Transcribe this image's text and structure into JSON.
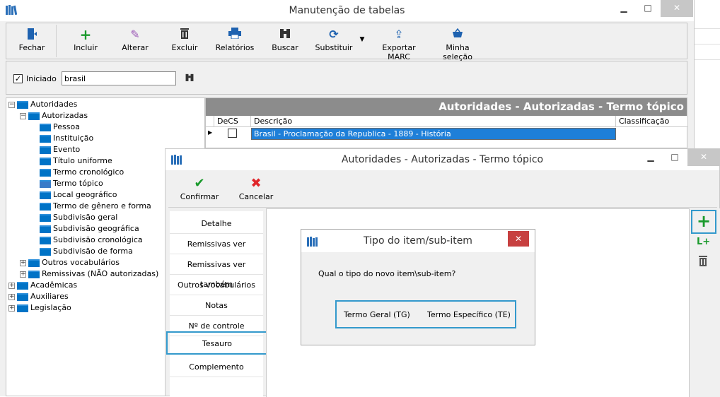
{
  "main_window": {
    "title": "Manutenção de tabelas",
    "minimize": "▁",
    "maximize": "□",
    "close": "✕"
  },
  "toolbar": {
    "fechar": "Fechar",
    "incluir": "Incluir",
    "alterar": "Alterar",
    "excluir": "Excluir",
    "relatorios": "Relatórios",
    "buscar": "Buscar",
    "substituir": "Substituir",
    "exportar": "Exportar MARC",
    "minha_selecao": "Minha seleção"
  },
  "filter": {
    "iniciado_label": "Iniciado",
    "iniciado_checked": "✓",
    "search_value": "brasil"
  },
  "tree": {
    "autoridades": "Autoridades",
    "autorizadas": "Autorizadas",
    "items": [
      "Pessoa",
      "Instituição",
      "Evento",
      "Título uniforme",
      "Termo cronológico",
      "Termo tópico",
      "Local geográfico",
      "Termo de gênero e forma",
      "Subdivisão geral",
      "Subdivisão geográfica",
      "Subdivisão cronológica",
      "Subdivisão de forma"
    ],
    "outros": "Outros vocabulários",
    "remissivas": "Remissivas (NÃO autorizadas)",
    "academicas": "Acadêmicas",
    "auxiliares": "Auxiliares",
    "legislacao": "Legislação"
  },
  "grid": {
    "heading": "Autoridades - Autorizadas - Termo tópico",
    "col_decs": "DeCS",
    "col_descricao": "Descrição",
    "col_classificacao": "Classificação",
    "row1_descricao": "Brasil - Proclamação da Republica - 1889 - História"
  },
  "child_window": {
    "title": "Autoridades - Autorizadas - Termo tópico",
    "confirmar": "Confirmar",
    "cancelar": "Cancelar",
    "tabs": [
      "Detalhe",
      "Remissivas ver",
      "Remissivas ver também",
      "Outros vocabulários",
      "Notas",
      "Nº de controle",
      "Tesauro",
      "Complemento"
    ],
    "selected_tab": "Tesauro"
  },
  "dialog": {
    "title": "Tipo do item/sub-item",
    "question": "Qual o tipo do novo item\\sub-item?",
    "btn_tg": "Termo Geral (TG)",
    "btn_te": "Termo Específico (TE)"
  },
  "colors": {
    "accent": "#3399cc",
    "folder": "#0073c6",
    "selection": "#1e7fd8",
    "header": "#8c8c8c"
  }
}
